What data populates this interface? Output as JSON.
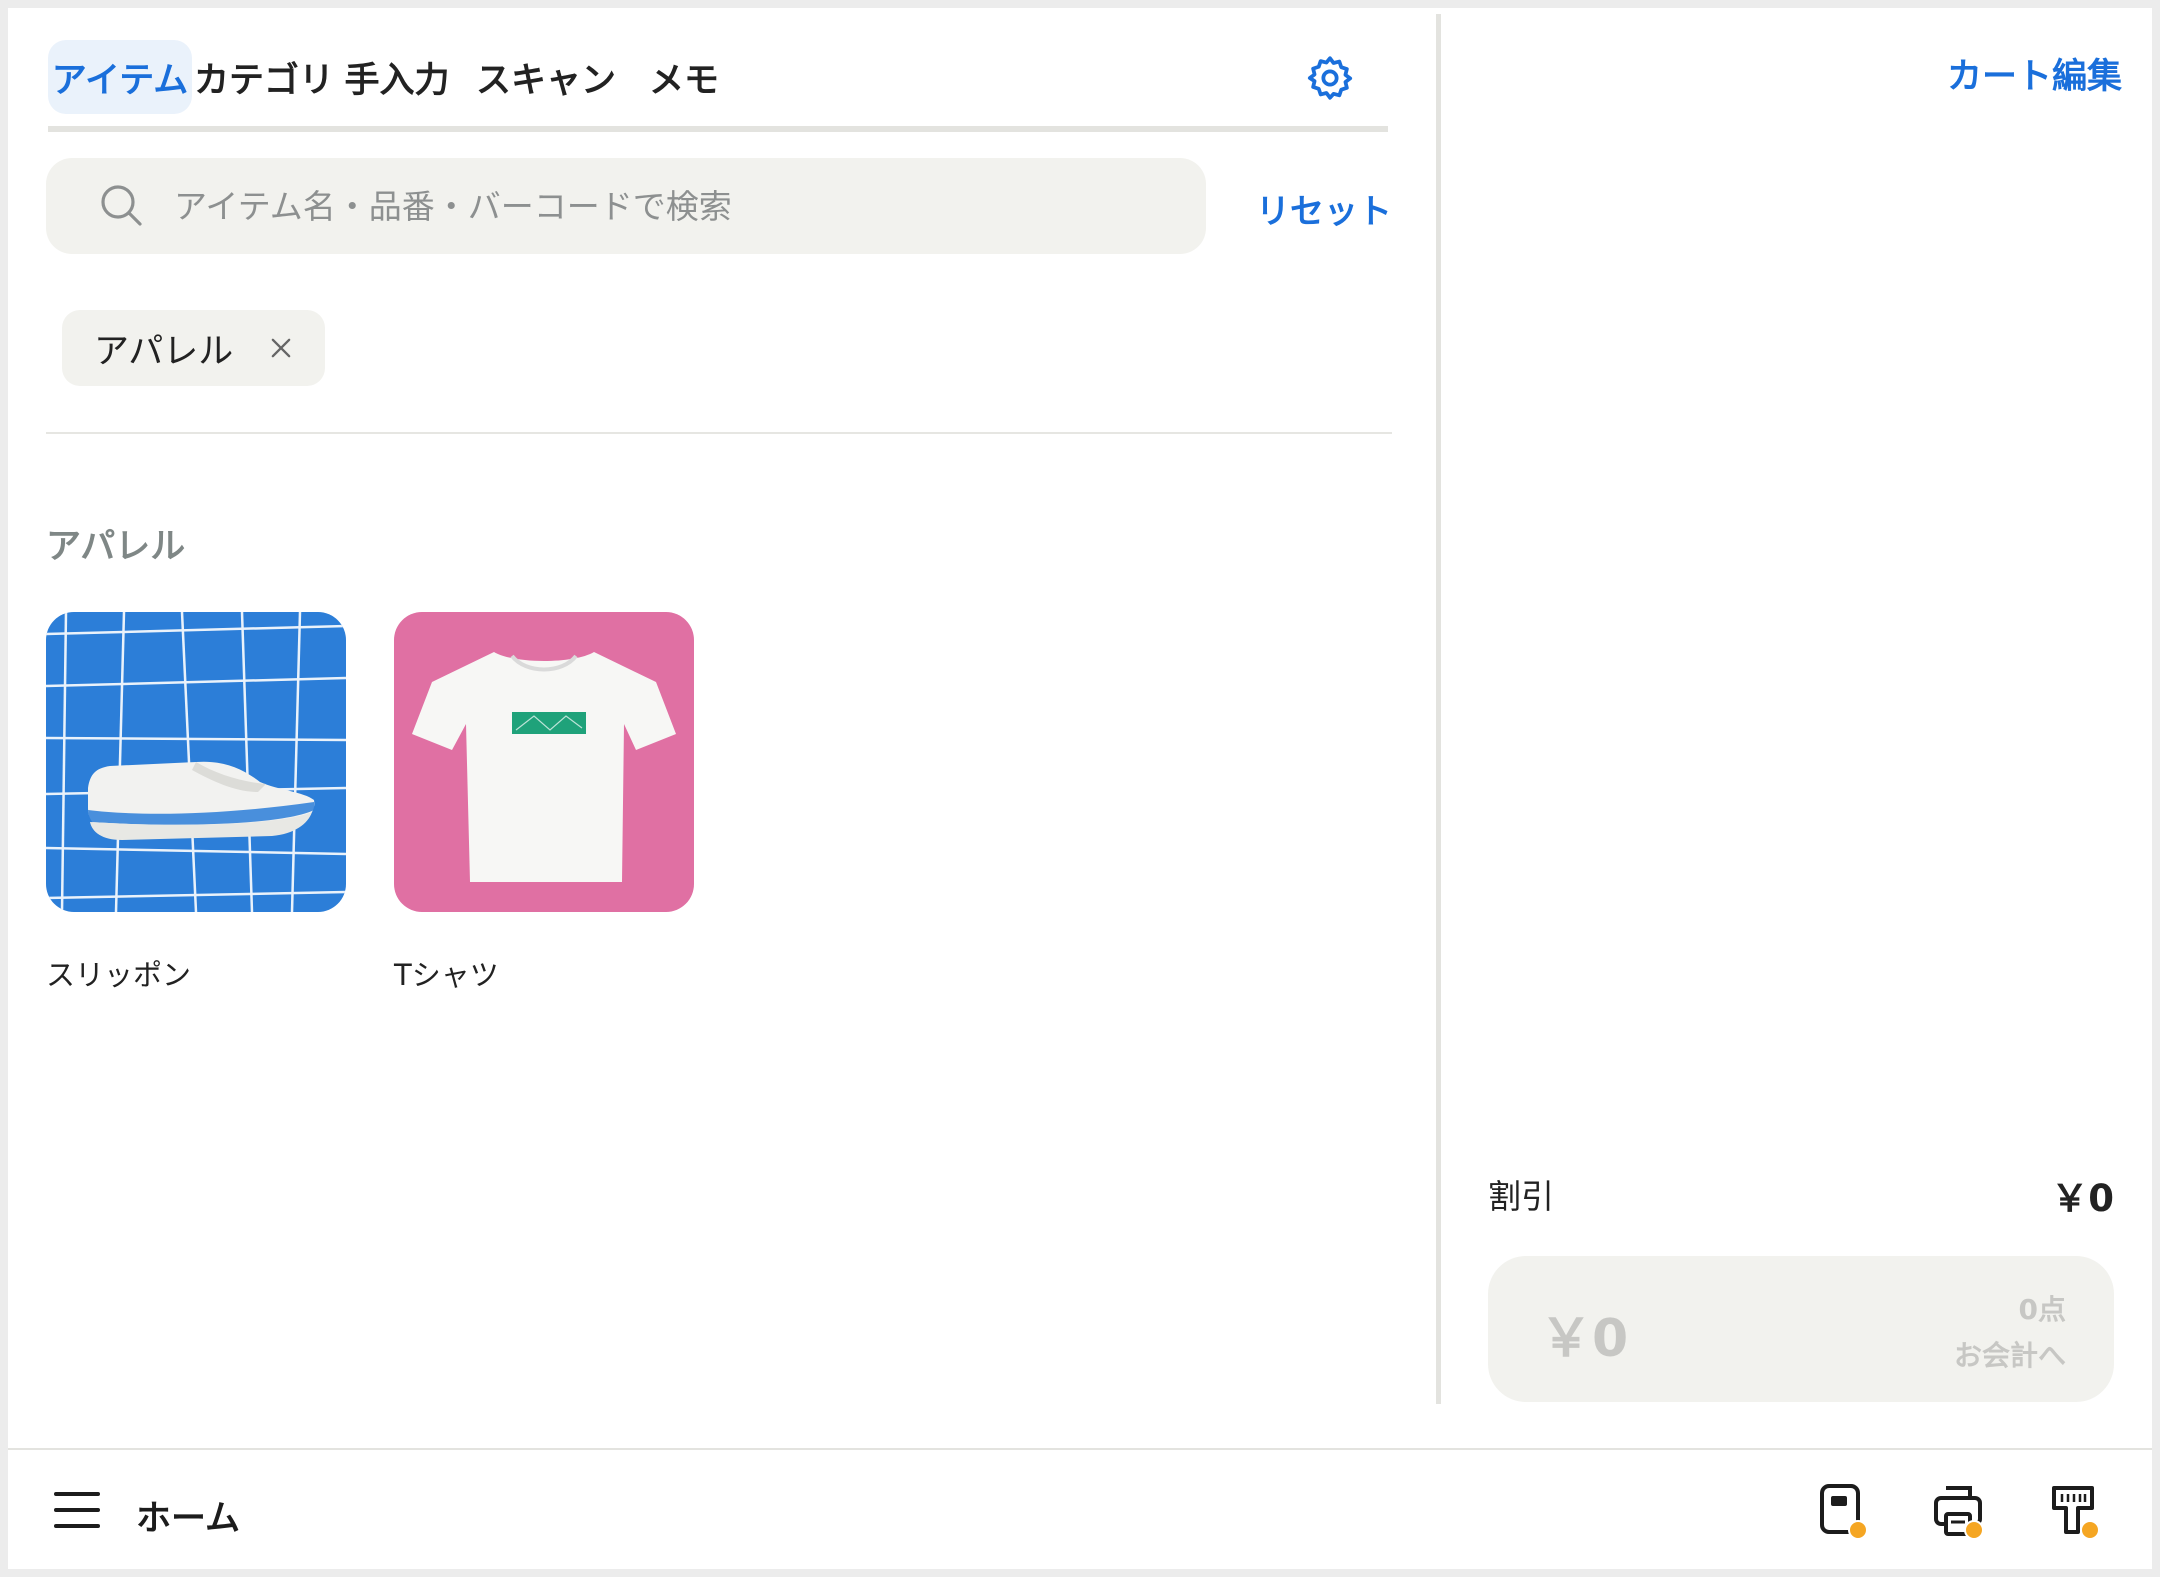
{
  "tabs": [
    {
      "label": "アイテム",
      "active": true
    },
    {
      "label": "カテゴリ",
      "active": false
    },
    {
      "label": "手入力",
      "active": false
    },
    {
      "label": "スキャン",
      "active": false
    },
    {
      "label": "メモ",
      "active": false
    }
  ],
  "search": {
    "placeholder": "アイテム名・品番・バーコードで検索",
    "value": "",
    "reset_label": "リセット"
  },
  "filter_chip": {
    "label": "アパレル"
  },
  "section": {
    "title": "アパレル"
  },
  "items": [
    {
      "label": "スリッポン",
      "thumb_color": "#2c7ed8"
    },
    {
      "label": "Tシャツ",
      "thumb_color": "#e070a3"
    }
  ],
  "cart": {
    "edit_label": "カート編集",
    "discount_label": "割引",
    "discount_value": "￥0",
    "total": "￥0",
    "count": "0点",
    "checkout_label": "お会計へ"
  },
  "bottom_bar": {
    "home_label": "ホーム",
    "device_icons": [
      "card-reader-icon",
      "receipt-printer-icon",
      "barcode-scanner-icon"
    ],
    "status_dot_color": "#f5a623"
  },
  "colors": {
    "accent": "#1a6fdb",
    "active_tab_bg": "#eaf2fb",
    "field_bg": "#f2f2ee",
    "muted_text": "#7f8786"
  }
}
